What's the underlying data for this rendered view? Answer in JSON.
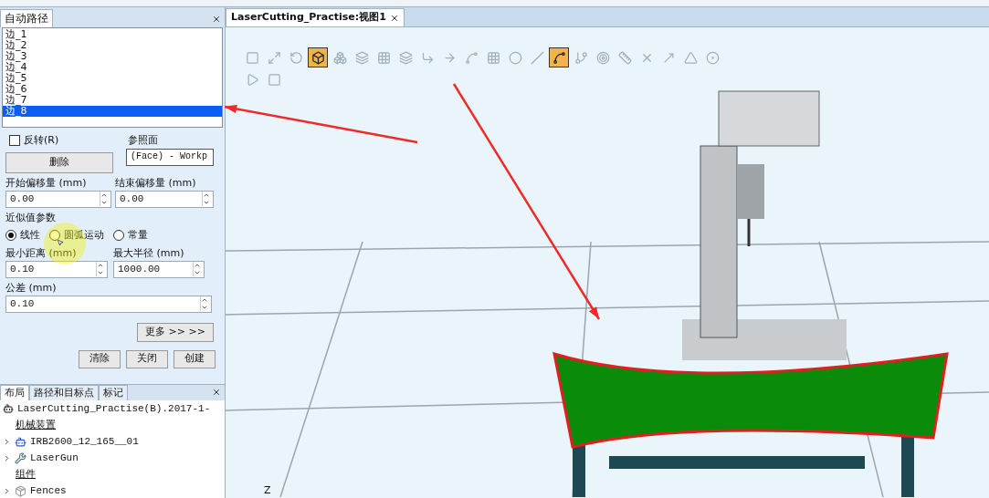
{
  "path_panel": {
    "title": "自动路径",
    "edges": [
      {
        "label": "边_1",
        "selected": false
      },
      {
        "label": "边_2",
        "selected": false
      },
      {
        "label": "边_3",
        "selected": false
      },
      {
        "label": "边_4",
        "selected": false
      },
      {
        "label": "边_5",
        "selected": false
      },
      {
        "label": "边_6",
        "selected": false
      },
      {
        "label": "边_7",
        "selected": false
      },
      {
        "label": "边_8",
        "selected": true
      }
    ],
    "reverse": {
      "label": "反转(R)",
      "checked": false
    },
    "delete_button": "删除",
    "reference_face": {
      "label": "参照面",
      "value": "(Face) - Workp"
    },
    "start_offset": {
      "label": "开始偏移量 (mm)",
      "value": "0.00"
    },
    "end_offset": {
      "label": "结束偏移量 (mm)",
      "value": "0.00"
    },
    "approx_title": "近似值参数",
    "approx_modes": [
      {
        "label": "线性",
        "selected": true
      },
      {
        "label": "圆弧运动",
        "selected": false
      },
      {
        "label": "常量",
        "selected": false
      }
    ],
    "min_distance": {
      "label": "最小距离 (mm)",
      "value": "0.10"
    },
    "max_radius": {
      "label": "最大半径 (mm)",
      "value": "1000.00"
    },
    "tolerance": {
      "label": "公差 (mm)",
      "value": "0.10"
    },
    "more_button": "更多 >> >>",
    "actions": [
      "清除",
      "关闭",
      "创建"
    ]
  },
  "layout_panel": {
    "tabs": [
      {
        "label": "布局",
        "selected": true
      },
      {
        "label": "路径和目标点",
        "selected": false
      },
      {
        "label": "标记",
        "selected": false
      }
    ],
    "station": "LaserCutting_Practise(B).2017-1-",
    "groups": [
      {
        "title": "机械装置",
        "children": [
          {
            "label": "IRB2600_12_165__01",
            "kind": "robot",
            "expanded": false
          },
          {
            "label": "LaserGun",
            "kind": "tool",
            "expanded": false
          }
        ]
      },
      {
        "title": "组件",
        "children": [
          {
            "label": "Fences",
            "kind": "part",
            "expanded": false
          }
        ]
      }
    ]
  },
  "view": {
    "tab": "LaserCutting_Practise:视图1",
    "toolbar": [
      {
        "selected": false
      },
      {
        "selected": false
      },
      {
        "selected": false
      },
      {
        "selected": true
      },
      {
        "selected": false
      },
      {
        "selected": false
      },
      {
        "selected": false
      },
      {
        "selected": false
      },
      {
        "selected": false
      },
      {
        "selected": false
      },
      {
        "selected": false
      },
      {
        "selected": false
      },
      {
        "selected": false
      },
      {
        "selected": false
      },
      {
        "selected": true
      },
      {
        "selected": false
      },
      {
        "selected": false
      },
      {
        "selected": false
      },
      {
        "selected": false
      },
      {
        "selected": false
      },
      {
        "selected": false
      },
      {
        "selected": false
      },
      {
        "selected": false
      },
      {
        "selected": false
      }
    ],
    "axis_label": "Z"
  }
}
